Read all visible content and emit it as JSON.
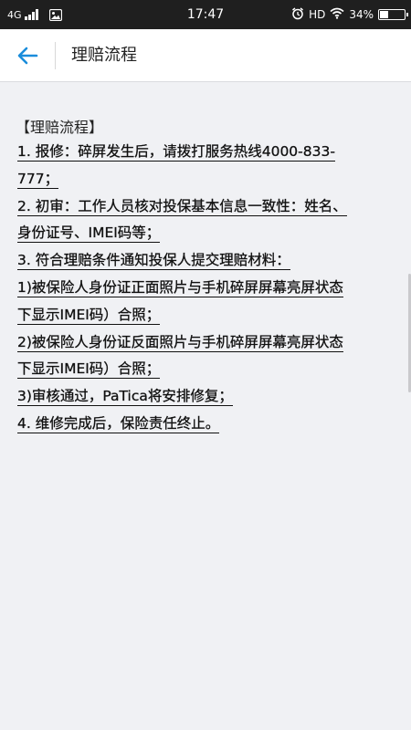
{
  "status_bar": {
    "network": "4G",
    "time": "17:47",
    "hd": "HD",
    "battery_percent": "34%",
    "battery_level": 0.34
  },
  "header": {
    "title": "理赔流程"
  },
  "content": {
    "heading": "【理赔流程】",
    "lines": [
      "1. 报修：碎屏发生后，请拨打服务热线4000-833-",
      "777；",
      "2. 初审：工作人员核对投保基本信息一致性：姓名、",
      "身份证号、IMEI码等；",
      "3. 符合理赔条件通知投保人提交理赔材料：",
      "1)被保险人身份证正面照片与手机碎屏屏幕亮屏状态",
      "下显示IMEI码）合照；",
      "2)被保险人身份证反面照片与手机碎屏屏幕亮屏状态",
      "下显示IMEI码）合照；",
      "3)审核通过，PaTica将安排修复；",
      "4. 维修完成后，保险责任终止。"
    ]
  },
  "icons": {
    "back": "back-arrow-icon",
    "notification": "gallery-notification-icon",
    "alarm": "alarm-clock-icon",
    "wifi": "wifi-icon",
    "signal": "signal-strength-icon",
    "battery": "battery-icon"
  },
  "colors": {
    "accent": "#1a8ddb",
    "status_bar": "#1f1f1f",
    "background": "#f0f1f4"
  }
}
